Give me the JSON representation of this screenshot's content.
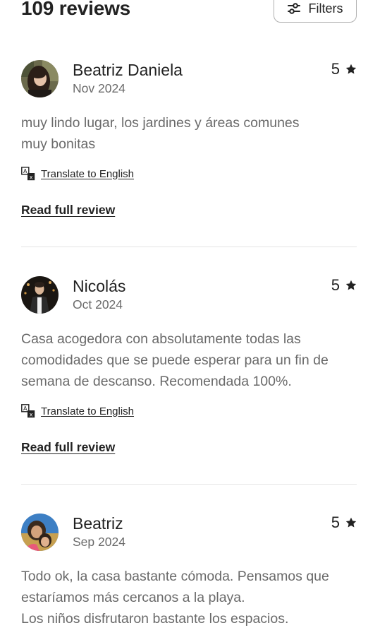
{
  "header": {
    "reviews_count": "109 reviews",
    "filters_label": "Filters",
    "filters_icon": "sliders-icon"
  },
  "reviews": [
    {
      "name": "Beatriz Daniela",
      "date": "Nov 2024",
      "rating": "5",
      "text": "muy lindo lugar, los jardines y áreas comunes\nmuy bonitas",
      "translate_label": "Translate to English",
      "read_full_label": "Read full review"
    },
    {
      "name": "Nicolás",
      "date": "Oct 2024",
      "rating": "5",
      "text": "Casa acogedora con absolutamente todas las\ncomodidades que se puede esperar para un fin de\nsemana de descanso. Recomendada 100%.",
      "translate_label": "Translate to English",
      "read_full_label": "Read full review"
    },
    {
      "name": "Beatriz",
      "date": "Sep 2024",
      "rating": "5",
      "text": "Todo ok, la casa bastante cómoda. Pensamos que\nestaríamos más cercanos a la playa.\nLos niños disfrutaron bastante los espacios."
    }
  ],
  "colors": {
    "text_primary": "#222222",
    "text_secondary": "#6a6a6a",
    "divider": "#e4e4e4",
    "button_border": "#b0b0b0"
  }
}
